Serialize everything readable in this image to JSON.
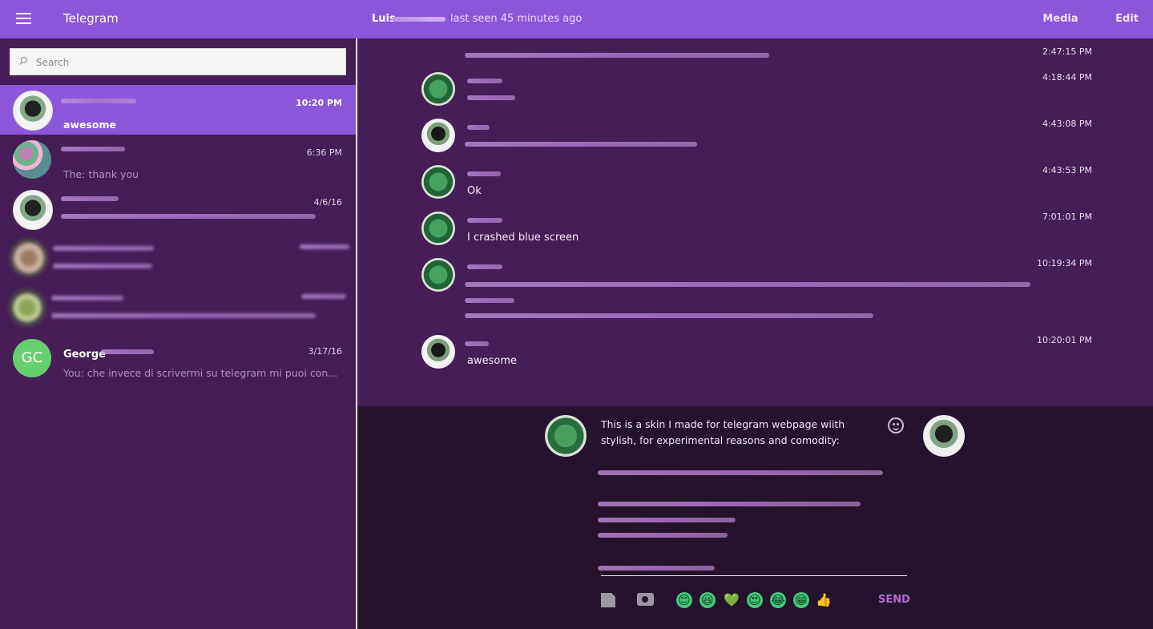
{
  "topbar": {
    "app_title": "Telegram",
    "peer_name": "Luis",
    "peer_status": "last seen 45 minutes ago",
    "media_label": "Media",
    "edit_label": "Edit"
  },
  "search": {
    "placeholder": "Search"
  },
  "chats": [
    {
      "name": "",
      "time": "10:20 PM",
      "preview": "awesome"
    },
    {
      "name": "",
      "time": "6:36 PM",
      "preview": "The: thank you"
    },
    {
      "name": "",
      "time": "4/6/16",
      "preview": ""
    },
    {
      "name": "",
      "time": "",
      "preview": ""
    },
    {
      "name": "",
      "time": "",
      "preview": ""
    },
    {
      "name": "George",
      "time": "3/17/16",
      "preview": "You: che invece di scrivermi su telegram mi puoi con...",
      "initials": "GC"
    }
  ],
  "messages": [
    {
      "time": "2:47:15 PM",
      "text": ""
    },
    {
      "time": "4:18:44 PM",
      "text": ""
    },
    {
      "time": "4:43:08 PM",
      "text": ""
    },
    {
      "time": "4:43:53 PM",
      "text": "Ok"
    },
    {
      "time": "7:01:01 PM",
      "text": "I crashed blue screen"
    },
    {
      "time": "10:19:34 PM",
      "text": ""
    },
    {
      "time": "10:20:01 PM",
      "text": "awesome"
    }
  ],
  "composer": {
    "text": "This is a skin I made for telegram webpage wiith stylish, for experimental reasons and comodity:",
    "send_label": "SEND",
    "emoji": [
      "😊",
      "😃",
      "💚",
      "😍",
      "😂",
      "😁",
      "👍"
    ]
  }
}
